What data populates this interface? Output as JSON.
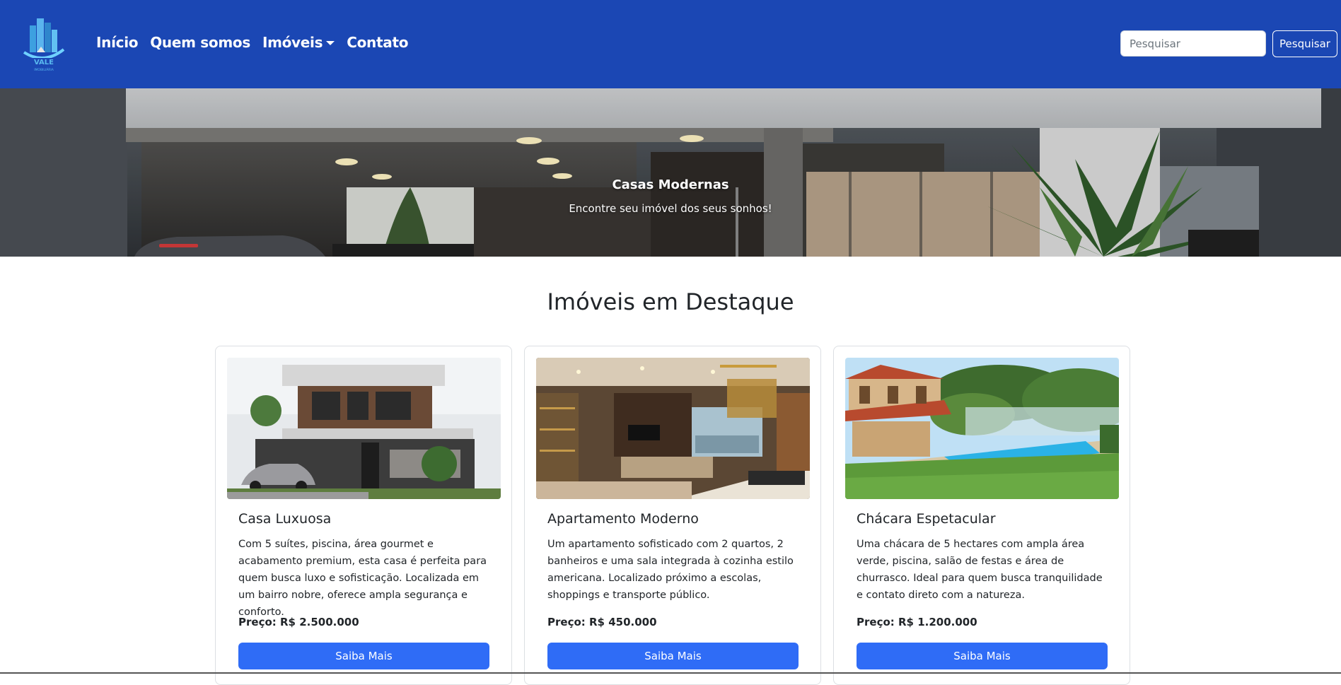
{
  "navbar": {
    "logo_text": "VALE",
    "logo_subtext": "IMOBILIÁRIA",
    "links": [
      {
        "label": "Início"
      },
      {
        "label": "Quem somos"
      },
      {
        "label": "Imóveis"
      },
      {
        "label": "Contato"
      }
    ],
    "search_placeholder": "Pesquisar",
    "search_button": "Pesquisar",
    "background_color": "#1b47b4"
  },
  "hero": {
    "title": "Casas Modernas",
    "subtitle": "Encontre seu imóvel dos seus sonhos!"
  },
  "section": {
    "title": "Imóveis em Destaque"
  },
  "cards": [
    {
      "title": "Casa Luxuosa",
      "text": "Com 5 suítes, piscina, área gourmet e acabamento premium, esta casa é perfeita para quem busca luxo e sofisticação. Localizada em um bairro nobre, oferece ampla segurança e conforto.",
      "price": "Preço: R$ 2.500.000",
      "button": "Saiba Mais"
    },
    {
      "title": "Apartamento Moderno",
      "text": "Um apartamento sofisticado com 2 quartos, 2 banheiros e uma sala integrada à cozinha estilo americana. Localizado próximo a escolas, shoppings e transporte público.",
      "price": "Preço: R$ 450.000",
      "button": "Saiba Mais"
    },
    {
      "title": "Chácara Espetacular",
      "text": "Uma chácara de 5 hectares com ampla área verde, piscina, salão de festas e área de churrasco. Ideal para quem busca tranquilidade e contato direto com a natureza.",
      "price": "Preço: R$ 1.200.000",
      "button": "Saiba Mais"
    }
  ],
  "colors": {
    "primary_button": "#2f6cf6",
    "nav_bg": "#1b47b4"
  }
}
